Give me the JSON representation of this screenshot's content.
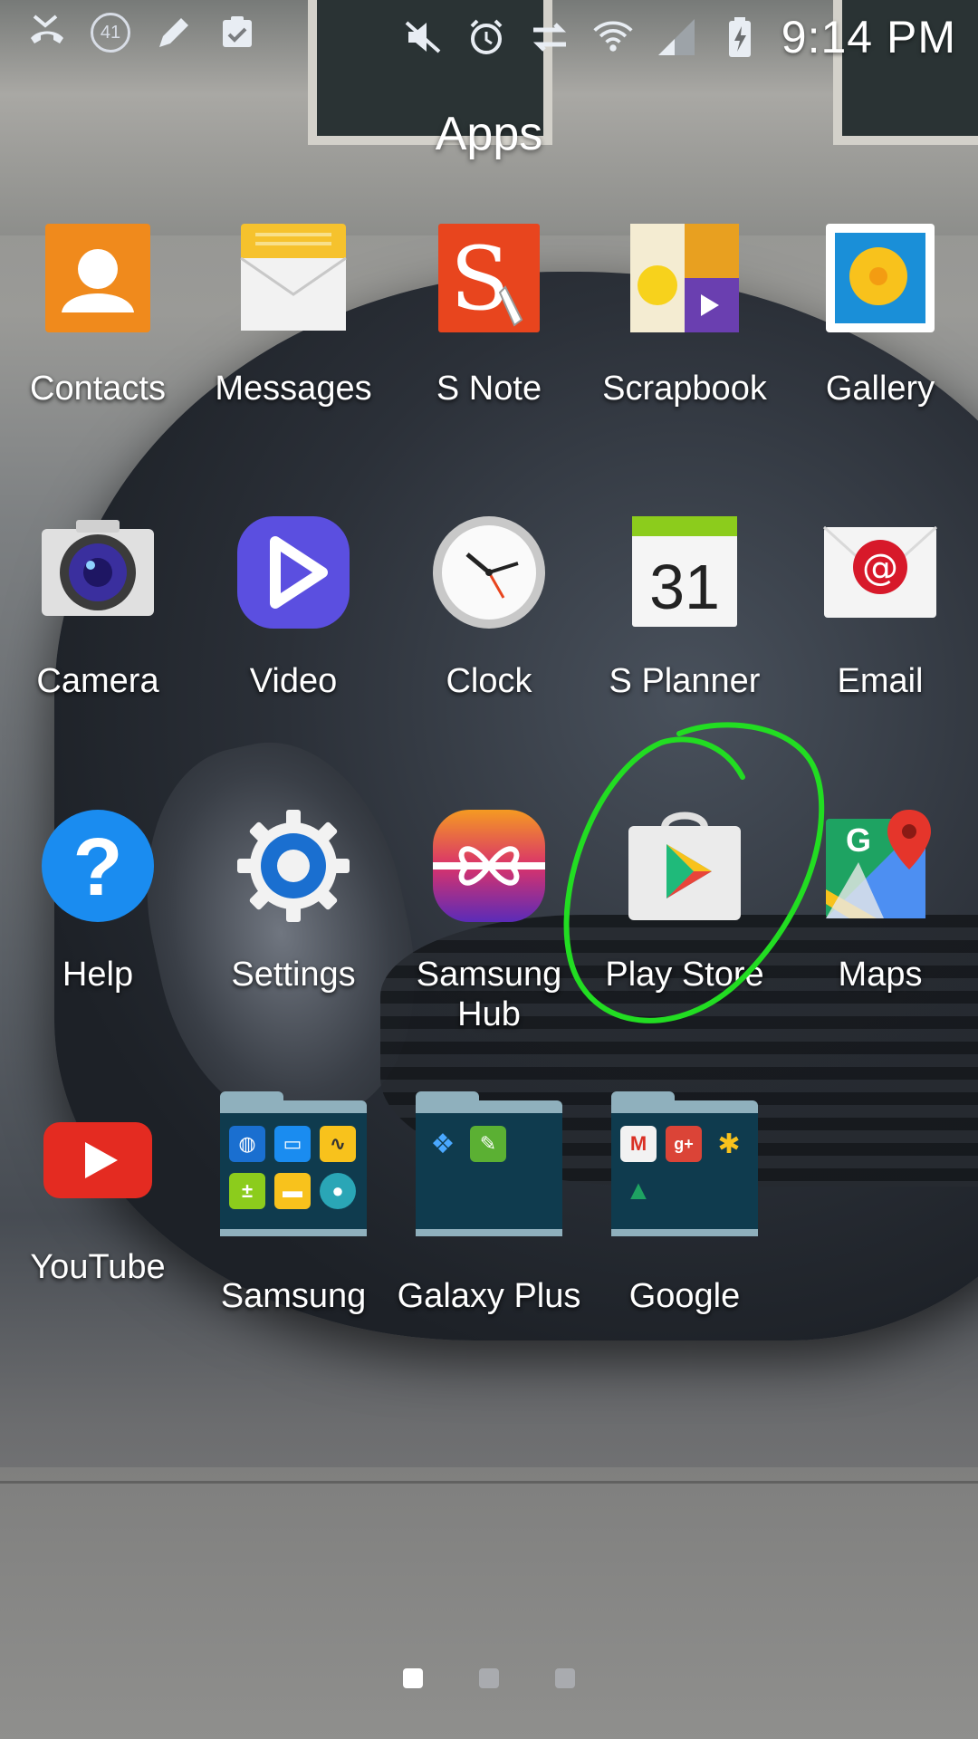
{
  "status_bar": {
    "time": "9:14 PM",
    "notification_count": "41",
    "icons": [
      "missed-call-icon",
      "notification-count-icon",
      "edit-icon",
      "clipboard-check-icon",
      "mute-icon",
      "alarm-icon",
      "data-transfer-icon",
      "wifi-icon",
      "signal-icon",
      "battery-charging-icon"
    ]
  },
  "page": {
    "title": "Apps"
  },
  "apps": [
    {
      "label": "Contacts"
    },
    {
      "label": "Messages"
    },
    {
      "label": "S Note"
    },
    {
      "label": "Scrapbook"
    },
    {
      "label": "Gallery"
    },
    {
      "label": "Camera"
    },
    {
      "label": "Video"
    },
    {
      "label": "Clock"
    },
    {
      "label": "S Planner",
      "date": "31"
    },
    {
      "label": "Email"
    },
    {
      "label": "Help"
    },
    {
      "label": "Settings"
    },
    {
      "label": "Samsung Hub"
    },
    {
      "label": "Play Store"
    },
    {
      "label": "Maps"
    },
    {
      "label": "YouTube"
    }
  ],
  "folders": [
    {
      "label": "Samsung"
    },
    {
      "label": "Galaxy Plus"
    },
    {
      "label": "Google"
    }
  ],
  "page_indicator": {
    "pages": 3,
    "active": 1
  },
  "colors": {
    "annotation": "#22dd22",
    "label": "#ffffff"
  }
}
